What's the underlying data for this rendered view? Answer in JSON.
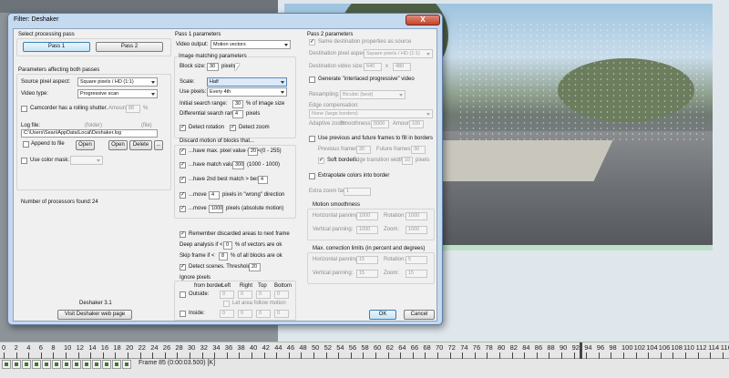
{
  "dialog": {
    "title": "Filter: Deshaker",
    "close_glyph": "X",
    "ok_label": "OK",
    "cancel_label": "Cancel"
  },
  "processing_pass": {
    "heading": "Select processing pass",
    "pass1_label": "Pass 1",
    "pass2_label": "Pass 2"
  },
  "both_passes": {
    "heading": "Parameters affecting both passes",
    "source_pixel_aspect_label": "Source pixel aspect:",
    "source_pixel_aspect_value": "Square pixels / HD  (1:1)",
    "video_type_label": "Video type:",
    "video_type_value": "Progressive scan",
    "rolling_shutter_label": "Camcorder has a rolling shutter.",
    "amount_label": "Amount:",
    "amount_value": "88",
    "amount_unit": "%",
    "log_file_label": "Log file:",
    "log_folder_label": "(folder)",
    "log_file_ext_label": "(file)",
    "log_file_value": "C:\\Users\\Sean\\AppData\\Local\\Deshaker.log",
    "append_label": "Append to file",
    "open_label": "Open",
    "open2_label": "Open",
    "delete_label": "Delete",
    "more_label": "...",
    "color_mask_label": "Use color mask:",
    "processors_label": "Number of processors found:",
    "processors_value": "24"
  },
  "footer": {
    "version": "Deshaker 3.1",
    "web_button": "Visit Deshaker web page"
  },
  "pass1": {
    "heading": "Pass 1 parameters",
    "video_output_label": "Video output:",
    "video_output_value": "Motion vectors",
    "image_matching_heading": "Image matching parameters",
    "block_size_label": "Block size:",
    "block_size_value": "30",
    "block_size_unit": "pixels",
    "scale_label": "Scale:",
    "scale_value": "Half",
    "use_pixels_label": "Use pixels:",
    "use_pixels_value": "Every 4th",
    "initial_search_label": "Initial search range:",
    "initial_search_value": "30",
    "initial_search_unit": "% of image size",
    "diff_search_label": "Differential search range:",
    "diff_search_value": "4",
    "diff_search_unit": "pixels",
    "detect_rotation_label": "Detect rotation",
    "detect_zoom_label": "Detect zoom",
    "discard_heading": "Discard motion of blocks that...",
    "max_pixel_label": "...have max. pixel value diff. <",
    "max_pixel_value": "20",
    "max_pixel_range": "(0 - 255)",
    "match_value_label": "...have match value <",
    "match_value_value": "300",
    "match_value_range": "(1000 - 1000)",
    "second_best_label": "...have 2nd best match > best -",
    "second_best_value": "4",
    "move_wrong_prefix": "...move >",
    "move_wrong_value": "4",
    "move_wrong_suffix": "pixels in \"wrong\" direction",
    "move_abs_prefix": "...move >",
    "move_abs_value": "1000",
    "move_abs_suffix": "pixels (absolute motion)",
    "remember_label": "Remember discarded areas to next frame",
    "deep_label": "Deep analysis if <",
    "deep_value": "0",
    "deep_unit": "% of vectors are ok",
    "skip_label": "Skip frame if <",
    "skip_value": "8",
    "skip_unit": "% of all blocks are ok",
    "detect_scenes_label": "Detect scenes. Threshold:",
    "detect_scenes_value": "20",
    "ignore_heading": "Ignore pixels",
    "from_border_label": "from border:",
    "left_h": "Left",
    "right_h": "Right",
    "top_h": "Top",
    "bottom_h": "Bottom",
    "outside_label": "Outside:",
    "inside_label": "Inside:",
    "zero": "0",
    "let_area_label": "Let area follow motion"
  },
  "pass2": {
    "heading": "Pass 2 parameters",
    "same_dest_label": "Same destination properties as source",
    "dest_pixel_label": "Destination pixel aspect:",
    "dest_pixel_value": "Square pixels / HD  (1:1)",
    "dest_size_label": "Destination video size:",
    "dest_w": "640",
    "dest_x": "x",
    "dest_h": "480",
    "interlaced_label": "Generate \"interlaced progressive\" video",
    "resampling_label": "Resampling:",
    "resampling_value": "Bicubic (best)",
    "edge_comp_label": "Edge compensation:",
    "edge_comp_value": "None (large borders)",
    "adaptive_label": "Adaptive zoom:",
    "smoothness_label": "Smoothness:",
    "smoothness_value": "5000",
    "amount_label": "Amount:",
    "amount_value": "100",
    "prev_future_label": "Use previous and future frames to fill in borders",
    "prev_frames_label": "Previous frames:",
    "prev_frames_value": "30",
    "future_frames_label": "Future frames:",
    "future_frames_value": "30",
    "soft_borders_label": "Soft borders.",
    "transition_label": "Edge transition width:",
    "transition_value": "10",
    "transition_unit": "pixels",
    "extrapolate_label": "Extrapolate colors into border",
    "extra_zoom_label": "Extra zoom factor:",
    "extra_zoom_value": "1",
    "motion_smooth_heading": "Motion smoothness",
    "h_pan_label": "Horizontal panning:",
    "h_pan_value": "1000",
    "rotation_label": "Rotation:",
    "rotation_value": "1000",
    "v_pan_label": "Vertical panning:",
    "v_pan_value": "1000",
    "zoom_label": "Zoom:",
    "zoom_value": "1000",
    "max_corr_heading": "Max. correction limits (in percent and degrees)",
    "h_pan2_value": "15",
    "rotation2_value": "5",
    "v_pan2_value": "15",
    "zoom2_value": "15"
  },
  "timeline": {
    "ticks": [
      "0",
      "2",
      "4",
      "6",
      "8",
      "10",
      "12",
      "14",
      "16",
      "18",
      "20",
      "22",
      "24",
      "26",
      "28",
      "30",
      "32",
      "34",
      "36",
      "38",
      "40",
      "42",
      "44",
      "46",
      "48",
      "50",
      "52",
      "54",
      "56",
      "58",
      "60",
      "62",
      "64",
      "66",
      "68",
      "70",
      "72",
      "74",
      "76",
      "78",
      "80",
      "82",
      "84",
      "86",
      "88",
      "90",
      "92",
      "94",
      "96",
      "98",
      "100",
      "102",
      "104",
      "106",
      "108",
      "110",
      "112",
      "114",
      "116"
    ],
    "frame_readout": "Frame 85 (0:00:03.500) [K]"
  }
}
